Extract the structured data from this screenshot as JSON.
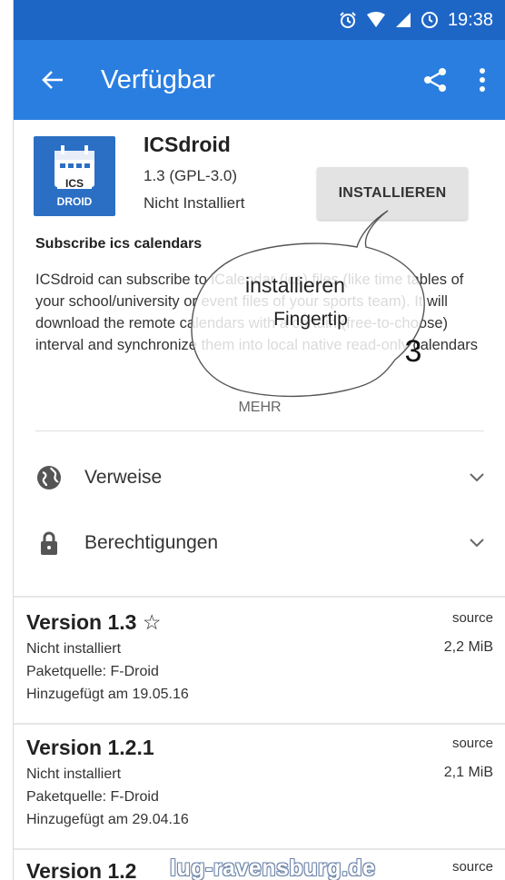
{
  "status_bar": {
    "time": "19:38"
  },
  "app_bar": {
    "title": "Verfügbar"
  },
  "app": {
    "icon_text_top": "ICS",
    "icon_text_bottom": "DROID",
    "name": "ICSdroid",
    "version": "1.3 (GPL-3.0)",
    "status": "Nicht Installiert",
    "install_label": "INSTALLIEREN"
  },
  "summary": "Subscribe ics calendars",
  "description": "ICSdroid can subscribe to iCalendar (ics) files (like time tables of your school/university or event files of your sports team). It will download the remote calendars with a certain (free-to-choose) interval and synchronize them into local native read-only calendars",
  "more_label": "MEHR",
  "sections": [
    {
      "label": "Verweise",
      "icon": "globe-icon"
    },
    {
      "label": "Berechtigungen",
      "icon": "lock-icon"
    }
  ],
  "versions": [
    {
      "title": "Version 1.3",
      "star": "☆",
      "status": "Nicht installiert",
      "repo": "Paketquelle: F-Droid",
      "added": "Hinzugefügt am 19.05.16",
      "source": "source",
      "size": "2,2 MiB"
    },
    {
      "title": "Version 1.2.1",
      "status": "Nicht installiert",
      "repo": "Paketquelle: F-Droid",
      "added": "Hinzugefügt am 29.04.16",
      "source": "source",
      "size": "2,1 MiB"
    },
    {
      "title": "Version 1.2",
      "source": "source"
    }
  ],
  "callout": {
    "line1": "installieren",
    "line2": "Fingertip",
    "step": "3"
  },
  "watermark": "lug-ravensburg.de",
  "colors": {
    "status_bar": "#1e66c6",
    "app_bar": "#2a7ee0",
    "install_button": "#e3e3e3"
  }
}
